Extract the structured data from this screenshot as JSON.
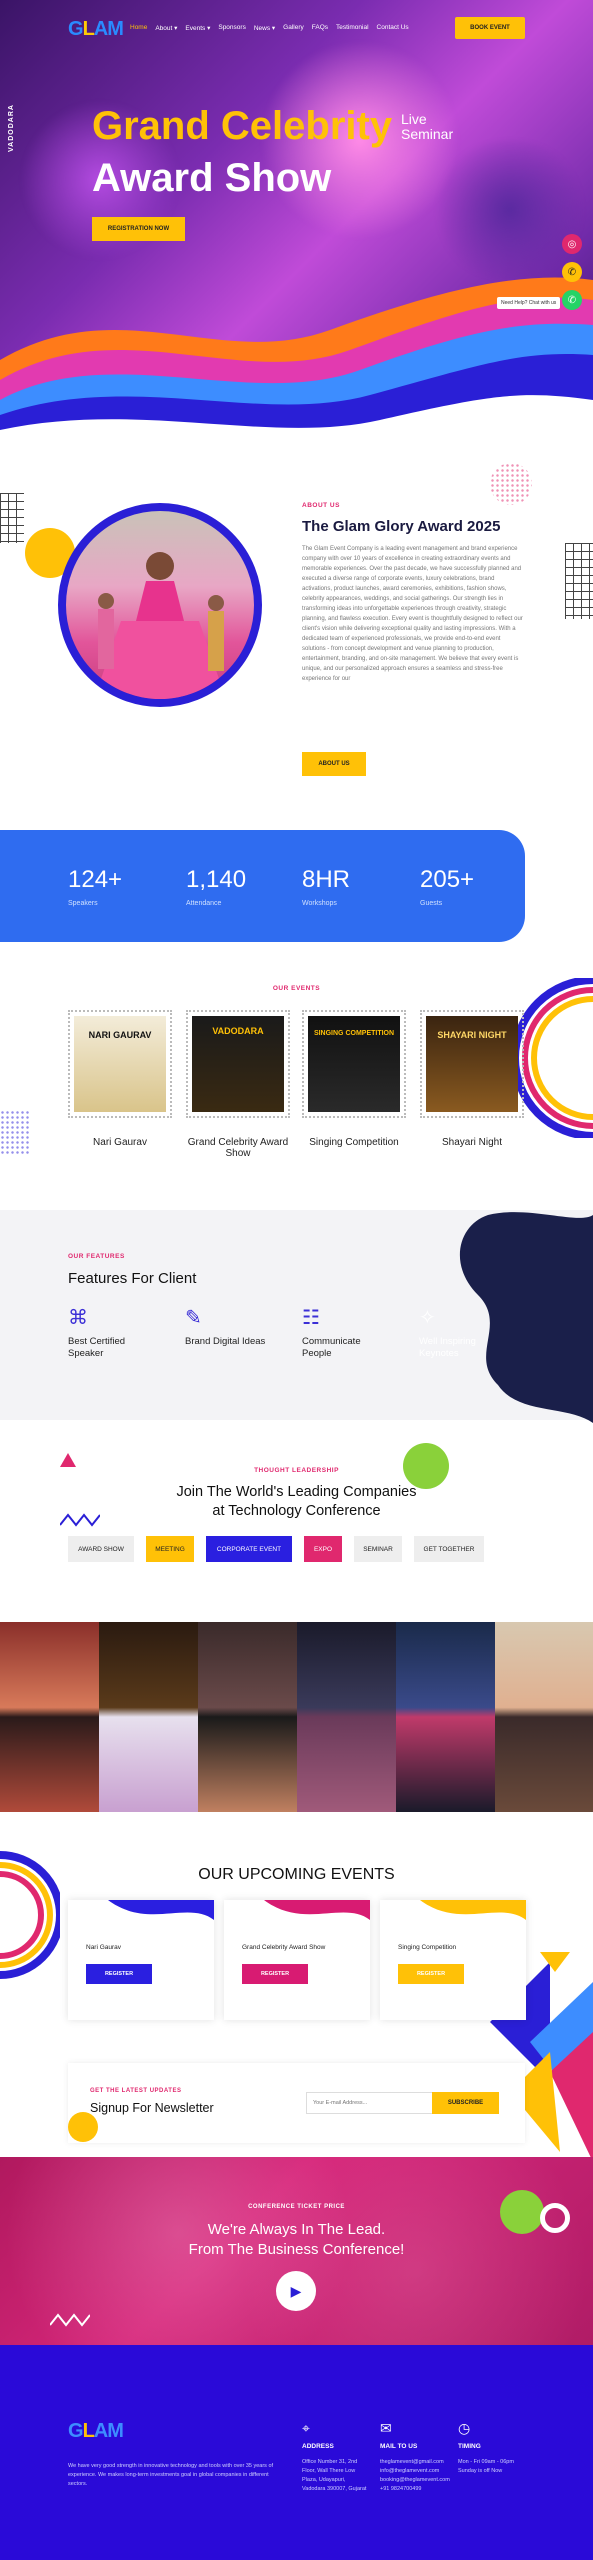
{
  "nav": {
    "items": [
      "Home",
      "About ▾",
      "Events ▾",
      "Sponsors",
      "News ▾",
      "Gallery",
      "FAQs",
      "Testimonial",
      "Contact Us"
    ],
    "book_label": "BOOK EVENT"
  },
  "hero": {
    "side_text": "VADODARA",
    "title_line1": "Grand Celebrity",
    "live_line1": "Live",
    "live_line2": "Seminar",
    "title_line2": "Award Show",
    "register_label": "REGISTRATION NOW",
    "help_label": "Need Help? Chat with us"
  },
  "about": {
    "tag": "ABOUT US",
    "title": "The Glam Glory Award 2025",
    "body": "The Glam Event Company is a leading event management and brand experience company with over 10 years of excellence in creating extraordinary events and memorable experiences. Over the past decade, we have successfully planned and executed a diverse range of corporate events, luxury celebrations, brand activations, product launches, award ceremonies, exhibitions, fashion shows, celebrity appearances, weddings, and social gatherings. Our strength lies in transforming ideas into unforgettable experiences through creativity, strategic planning, and flawless execution. Every event is thoughtfully designed to reflect our client's vision while delivering exceptional quality and lasting impressions. With a dedicated team of experienced professionals, we provide end-to-end event solutions - from concept development and venue planning to production, entertainment, branding, and on-site management. We believe that every event is unique, and our personalized approach ensures a seamless and stress-free experience for our",
    "button_label": "ABOUT US"
  },
  "stats": [
    {
      "number": "124+",
      "label": "Speakers"
    },
    {
      "number": "1,140",
      "label": "Attendance"
    },
    {
      "number": "8HR",
      "label": "Workshops"
    },
    {
      "number": "205+",
      "label": "Guests"
    }
  ],
  "events": {
    "tag": "OUR EVENTS",
    "items": [
      {
        "name": "Nari Gaurav",
        "poster_text": "NARI GAURAV"
      },
      {
        "name": "Grand Celebrity Award Show",
        "poster_text": "VADODARA"
      },
      {
        "name": "Singing Competition",
        "poster_text": "SINGING COMPETITION"
      },
      {
        "name": "Shayari Night",
        "poster_text": "SHAYARI NIGHT"
      }
    ]
  },
  "features": {
    "tag": "OUR FEATURES",
    "title": "Features For Client",
    "items": [
      {
        "title": "Best Certified Speaker",
        "icon": "certificate-icon"
      },
      {
        "title": "Brand Digital Ideas",
        "icon": "digital-ideas-icon"
      },
      {
        "title": "Communicate People",
        "icon": "people-icon"
      },
      {
        "title": "Well Inspiring Keynotes",
        "icon": "keynote-icon"
      }
    ]
  },
  "thought": {
    "tag": "THOUGHT LEADERSHIP",
    "title_line1": "Join The World's Leading Companies",
    "title_line2": "at Technology Conference",
    "pills": [
      "AWARD SHOW",
      "MEETING",
      "CORPORATE EVENT",
      "EXPO",
      "SEMINAR",
      "GET TOGETHER"
    ]
  },
  "upcoming": {
    "title": "OUR UPCOMING EVENTS",
    "items": [
      {
        "name": "Nari Gaurav",
        "button": "REGISTER",
        "color": "#2a1fe0"
      },
      {
        "name": "Grand Celebrity Award Show",
        "button": "REGISTER",
        "color": "#d81b72"
      },
      {
        "name": "Singing Competition",
        "button": "REGISTER",
        "color": "#ffc107"
      }
    ]
  },
  "newsletter": {
    "tag": "GET THE LATEST UPDATES",
    "title": "Signup For Newsletter",
    "placeholder": "Your E-mail Address...",
    "button": "SUBSCRIBE"
  },
  "conference": {
    "tag": "CONFERENCE TICKET PRICE",
    "line1": "We're Always In The Lead.",
    "line2": "From The Business Conference!"
  },
  "footer": {
    "about": "We have very good strength in innovative technology and tools with over 35 years of experience. We makes long-term investments goal in global companies in different sectors.",
    "address_title": "ADDRESS",
    "address": [
      "Office Number 31, 2nd",
      "Floor, Wall There Low",
      "Plaza, Udayapuri,",
      "Vadodara 390007, Gujarat"
    ],
    "mail_title": "MAIL TO US",
    "mail": [
      "theglamevent@gmail.com",
      "info@theglamevent.com",
      "booking@theglamevent.com",
      "+91 9824700499"
    ],
    "timing_title": "TIMING",
    "timing": [
      "Mon - Fri 09am - 06pm",
      "Sunday is off Now"
    ]
  },
  "colors": {
    "accent_yellow": "#ffc107",
    "brand_blue": "#2f6cf0",
    "brand_pink": "#e0286e",
    "footer_blue": "#2a0ad8"
  }
}
